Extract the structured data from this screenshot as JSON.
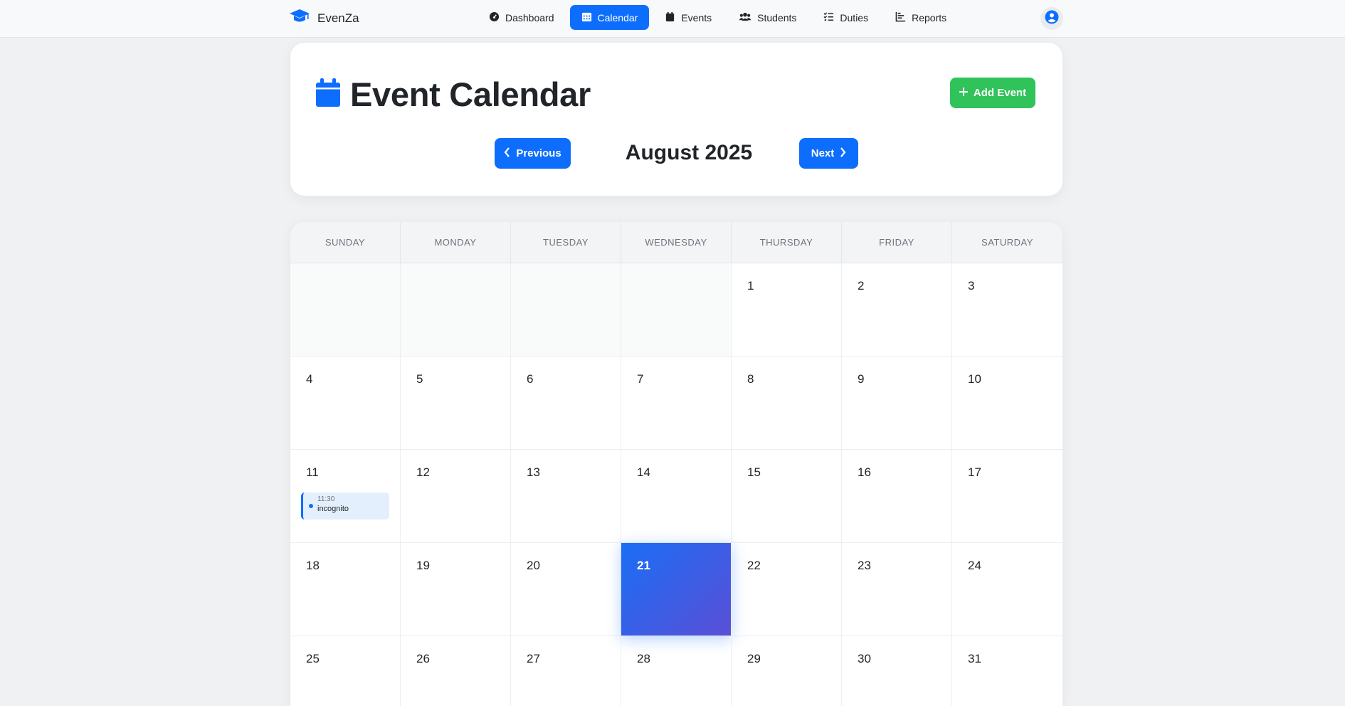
{
  "brand": {
    "name": "EvenZa",
    "icon": "graduation-cap-icon"
  },
  "nav": {
    "items": [
      {
        "label": "Dashboard",
        "icon": "gauge-icon",
        "active": false
      },
      {
        "label": "Calendar",
        "icon": "calendar-icon",
        "active": true
      },
      {
        "label": "Events",
        "icon": "calendar-solid-icon",
        "active": false
      },
      {
        "label": "Students",
        "icon": "users-icon",
        "active": false
      },
      {
        "label": "Duties",
        "icon": "list-check-icon",
        "active": false
      },
      {
        "label": "Reports",
        "icon": "chart-bar-icon",
        "active": false
      }
    ],
    "user_icon": "user-circle-icon"
  },
  "header": {
    "title": "Event Calendar",
    "add_label": "Add Event",
    "prev_label": "Previous",
    "next_label": "Next",
    "month": "August 2025"
  },
  "calendar": {
    "weekdays": [
      "SUNDAY",
      "MONDAY",
      "TUESDAY",
      "WEDNESDAY",
      "THURSDAY",
      "FRIDAY",
      "SATURDAY"
    ],
    "leading_empty": 4,
    "days_in_month": 31,
    "today": 21,
    "events": [
      {
        "day": 11,
        "time": "11:30",
        "title": "incognito"
      }
    ]
  },
  "colors": {
    "primary": "#0d6efd",
    "success": "#2fc35a",
    "today_gradient_start": "#1a6ef5",
    "today_gradient_end": "#5a4fd6"
  }
}
